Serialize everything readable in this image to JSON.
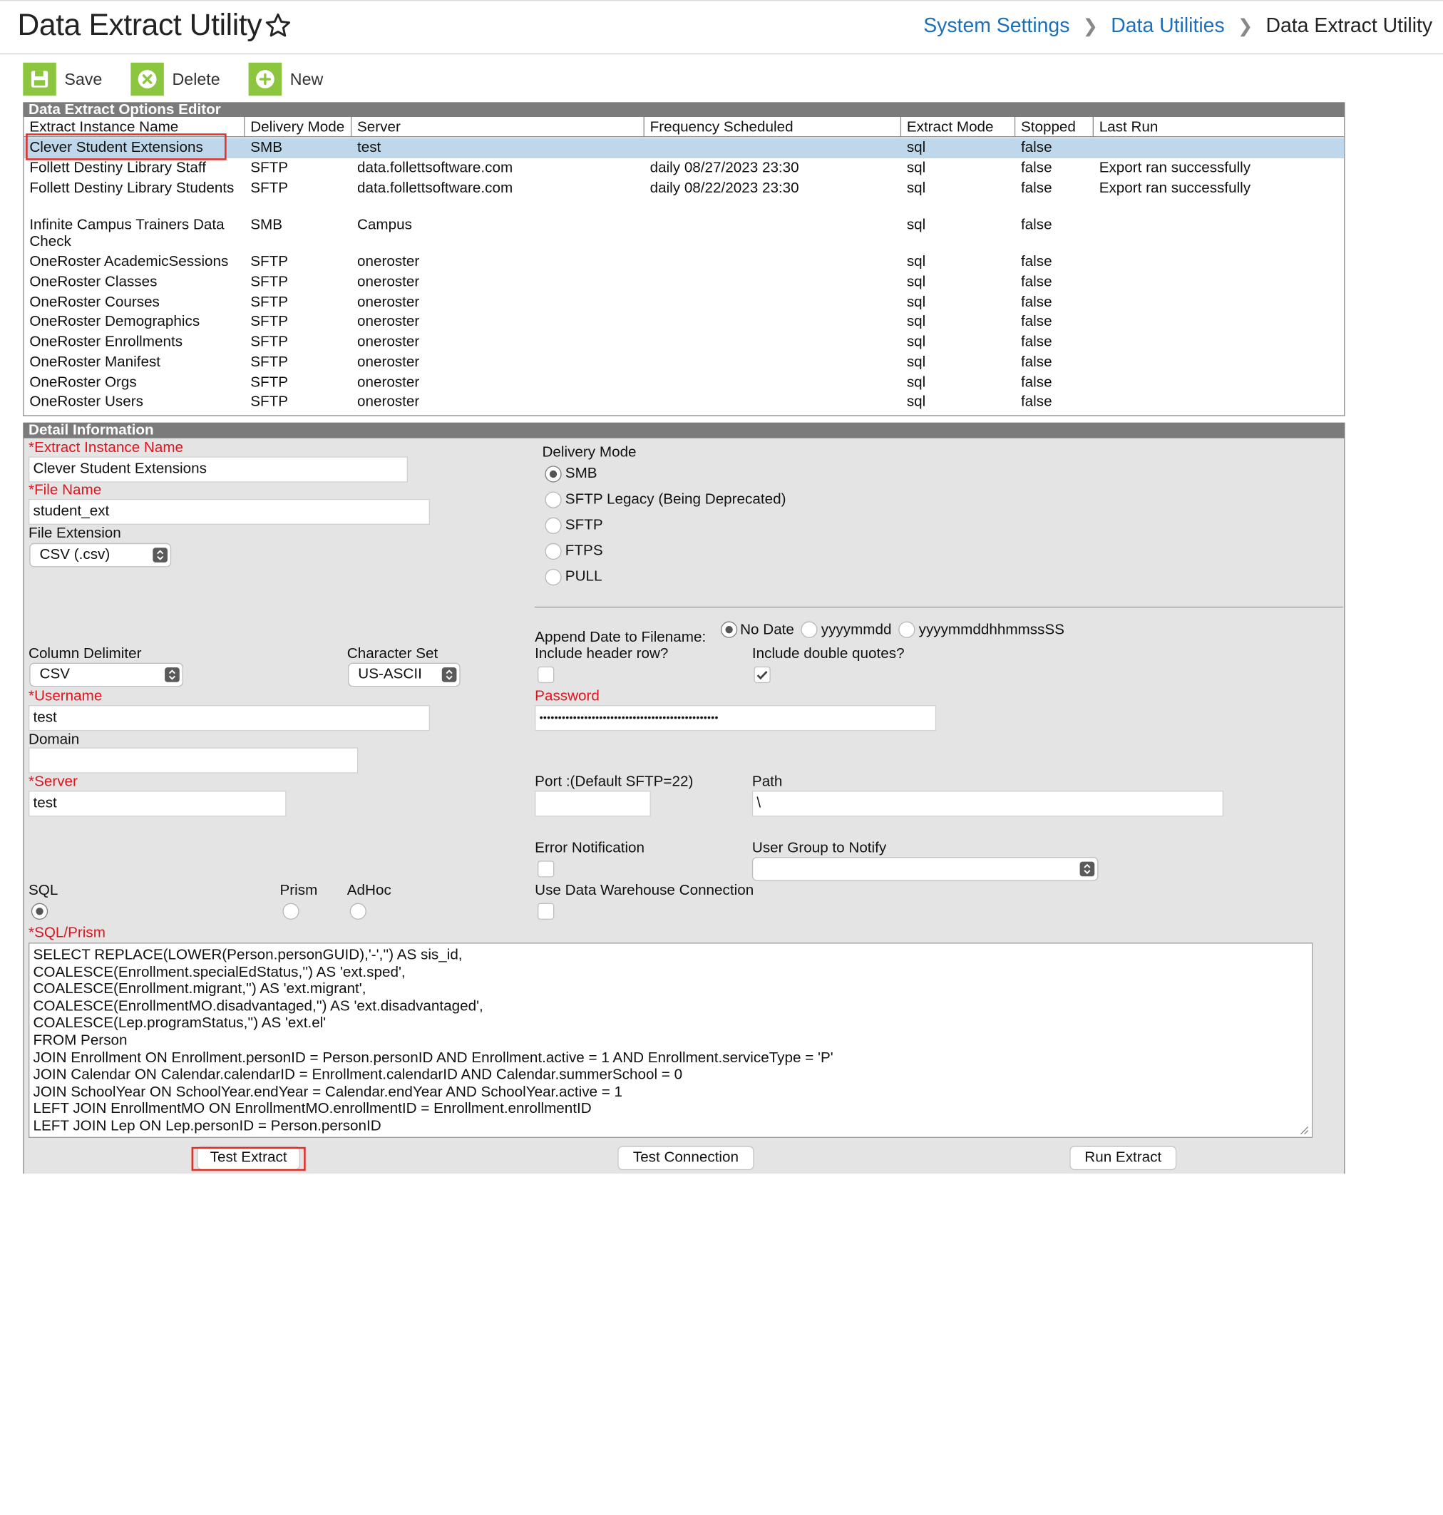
{
  "header": {
    "title": "Data Extract Utility",
    "breadcrumb": [
      "System Settings",
      "Data Utilities",
      "Data Extract Utility"
    ]
  },
  "toolbar": {
    "save_label": "Save",
    "delete_label": "Delete",
    "new_label": "New"
  },
  "options_editor": {
    "title": "Data Extract Options Editor",
    "columns": [
      "Extract Instance Name",
      "Delivery Mode",
      "Server",
      "Frequency Scheduled",
      "Extract Mode",
      "Stopped",
      "Last Run"
    ],
    "rows": [
      {
        "name": "Clever Student Extensions",
        "mode": "SMB",
        "server": "test",
        "freq": "",
        "extract": "sql",
        "stopped": "false",
        "last": ""
      },
      {
        "name": "Follett Destiny Library Staff",
        "mode": "SFTP",
        "server": "data.follettsoftware.com",
        "freq": "daily 08/27/2023 23:30",
        "extract": "sql",
        "stopped": "false",
        "last": "Export ran successfully"
      },
      {
        "name": "Follett Destiny Library Students",
        "mode": "SFTP",
        "server": "data.follettsoftware.com",
        "freq": "daily 08/22/2023 23:30",
        "extract": "sql",
        "stopped": "false",
        "last": "Export ran successfully"
      },
      {
        "name": "Infinite Campus Trainers Data Check",
        "mode": "SMB",
        "server": "Campus",
        "freq": "",
        "extract": "sql",
        "stopped": "false",
        "last": ""
      },
      {
        "name": "OneRoster AcademicSessions",
        "mode": "SFTP",
        "server": "oneroster",
        "freq": "",
        "extract": "sql",
        "stopped": "false",
        "last": ""
      },
      {
        "name": "OneRoster Classes",
        "mode": "SFTP",
        "server": "oneroster",
        "freq": "",
        "extract": "sql",
        "stopped": "false",
        "last": ""
      },
      {
        "name": "OneRoster Courses",
        "mode": "SFTP",
        "server": "oneroster",
        "freq": "",
        "extract": "sql",
        "stopped": "false",
        "last": ""
      },
      {
        "name": "OneRoster Demographics",
        "mode": "SFTP",
        "server": "oneroster",
        "freq": "",
        "extract": "sql",
        "stopped": "false",
        "last": ""
      },
      {
        "name": "OneRoster Enrollments",
        "mode": "SFTP",
        "server": "oneroster",
        "freq": "",
        "extract": "sql",
        "stopped": "false",
        "last": ""
      },
      {
        "name": "OneRoster Manifest",
        "mode": "SFTP",
        "server": "oneroster",
        "freq": "",
        "extract": "sql",
        "stopped": "false",
        "last": ""
      },
      {
        "name": "OneRoster Orgs",
        "mode": "SFTP",
        "server": "oneroster",
        "freq": "",
        "extract": "sql",
        "stopped": "false",
        "last": ""
      },
      {
        "name": "OneRoster Users",
        "mode": "SFTP",
        "server": "oneroster",
        "freq": "",
        "extract": "sql",
        "stopped": "false",
        "last": ""
      }
    ]
  },
  "detail": {
    "title": "Detail Information",
    "extract_instance_name_label": "*Extract Instance Name",
    "extract_instance_name_value": "Clever Student Extensions",
    "file_name_label": "*File Name",
    "file_name_value": "student_ext",
    "file_extension_label": "File Extension",
    "file_extension_value": "CSV (.csv)",
    "delivery_mode_label": "Delivery Mode",
    "delivery_modes": [
      "SMB",
      "SFTP Legacy (Being Deprecated)",
      "SFTP",
      "FTPS",
      "PULL"
    ],
    "delivery_mode_selected": "SMB",
    "append_date_label": "Append Date to Filename:",
    "append_date_options": [
      "No Date",
      "yyyymmdd",
      "yyyymmddhhmmssSS"
    ],
    "append_date_selected": "No Date",
    "column_delimiter_label": "Column Delimiter",
    "column_delimiter_value": "CSV",
    "character_set_label": "Character Set",
    "character_set_value": "US-ASCII",
    "include_header_label": "Include header row?",
    "include_header_checked": false,
    "include_quotes_label": "Include double quotes?",
    "include_quotes_checked": true,
    "username_label": "*Username",
    "username_value": "test",
    "password_label": "Password",
    "password_value": "••••••••••••••••••••••••••••••••••••••••••••••••",
    "domain_label": "Domain",
    "domain_value": "",
    "server_label": "*Server",
    "server_value": "test",
    "port_label": "Port :(Default SFTP=22)",
    "port_value": "",
    "path_label": "Path",
    "path_value": "\\",
    "error_notification_label": "Error Notification",
    "error_notification_checked": false,
    "user_group_label": "User Group to Notify",
    "user_group_value": "",
    "sql_label": "SQL",
    "prism_label": "Prism",
    "adhoc_label": "AdHoc",
    "query_type_selected": "SQL",
    "warehouse_label": "Use Data Warehouse Connection",
    "warehouse_checked": false,
    "sql_prism_label": "*SQL/Prism",
    "sql_text": "SELECT REPLACE(LOWER(Person.personGUID),'-','') AS sis_id,\nCOALESCE(Enrollment.specialEdStatus,'') AS 'ext.sped',\nCOALESCE(Enrollment.migrant,'') AS 'ext.migrant',\nCOALESCE(EnrollmentMO.disadvantaged,'') AS 'ext.disadvantaged',\nCOALESCE(Lep.programStatus,'') AS 'ext.el'\nFROM Person\nJOIN Enrollment ON Enrollment.personID = Person.personID AND Enrollment.active = 1 AND Enrollment.serviceType = 'P'\nJOIN Calendar ON Calendar.calendarID = Enrollment.calendarID AND Calendar.summerSchool = 0\nJOIN SchoolYear ON SchoolYear.endYear = Calendar.endYear AND SchoolYear.active = 1\nLEFT JOIN EnrollmentMO ON EnrollmentMO.enrollmentID = Enrollment.enrollmentID\nLEFT JOIN Lep ON Lep.personID = Person.personID",
    "test_extract_label": "Test Extract",
    "test_connection_label": "Test Connection",
    "run_extract_label": "Run Extract"
  },
  "colors": {
    "accent_green": "#8cc63f",
    "link_blue": "#1d6fb8",
    "panel_header": "#7b7b7b",
    "selected_row": "#bfd7ea",
    "required_red": "#e0141e",
    "highlight_outline": "#e0322c"
  },
  "icons": {
    "favorite": "star-outline-icon",
    "save": "floppy-disk-icon",
    "delete": "x-circle-icon",
    "new": "plus-circle-icon",
    "breadcrumb_separator": "chevron-right-icon"
  }
}
